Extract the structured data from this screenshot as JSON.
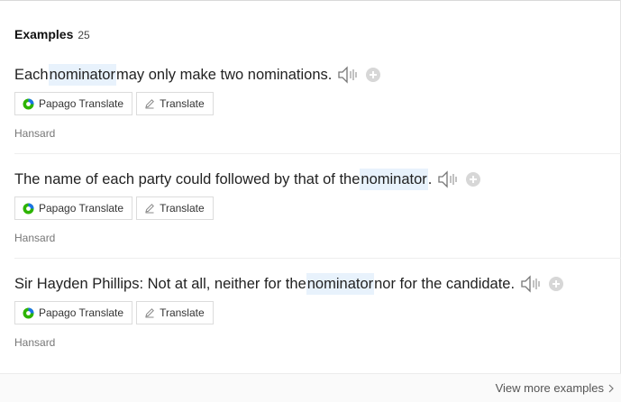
{
  "section": {
    "title": "Examples",
    "count": "25"
  },
  "examples": [
    {
      "before": "Each ",
      "keyword": "nominator",
      "after": " may only make two nominations.",
      "papago_label": "Papago Translate",
      "translate_label": "Translate",
      "source": "Hansard"
    },
    {
      "before": "The name of each party could followed by that of the ",
      "keyword": "nominator",
      "after": ".",
      "papago_label": "Papago Translate",
      "translate_label": "Translate",
      "source": "Hansard"
    },
    {
      "before": "Sir Hayden Phillips: Not at all, neither for the ",
      "keyword": "nominator",
      "after": " nor for the candidate.",
      "papago_label": "Papago Translate",
      "translate_label": "Translate",
      "source": "Hansard"
    }
  ],
  "footer": {
    "more_label": "View more examples"
  },
  "colors": {
    "highlight": "#e8f2fc",
    "papago_green": "#2db400",
    "papago_blue": "#1a73e8"
  },
  "icons": [
    "speaker-icon",
    "add-icon",
    "papago-icon",
    "pencil-icon",
    "chevron-right-icon"
  ]
}
